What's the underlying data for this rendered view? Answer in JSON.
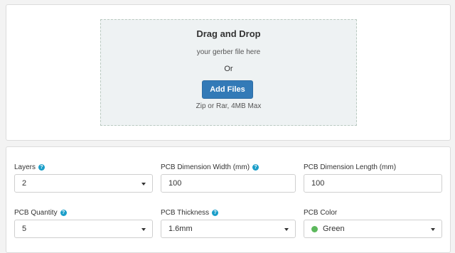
{
  "upload": {
    "title": "Drag and Drop",
    "subtitle": "your gerber file here",
    "or_text": "Or",
    "button_label": "Add Files",
    "hint": "Zip or Rar, 4MB Max"
  },
  "options": {
    "layers": {
      "label": "Layers",
      "value": "2"
    },
    "width": {
      "label": "PCB Dimension Width (mm)",
      "value": "100"
    },
    "length": {
      "label": "PCB Dimension Length (mm)",
      "value": "100"
    },
    "quantity": {
      "label": "PCB Quantity",
      "value": "5"
    },
    "thickness": {
      "label": "PCB Thickness",
      "value": "1.6mm"
    },
    "color": {
      "label": "PCB Color",
      "value": "Green",
      "swatch": "#5cb85c"
    }
  },
  "colors": {
    "accent": "#337ab7",
    "help": "#1a9ec9"
  },
  "icons": {
    "help": "question-circle-icon",
    "dropdown": "caret-down-icon"
  }
}
